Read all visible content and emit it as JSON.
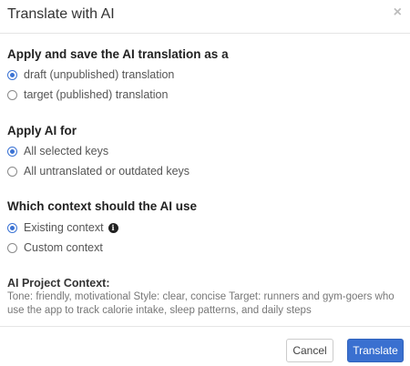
{
  "dialog": {
    "title": "Translate with AI",
    "close_symbol": "×"
  },
  "sections": {
    "apply_save": {
      "title": "Apply and save the AI translation as a",
      "options": [
        {
          "label": "draft (unpublished) translation",
          "checked": true
        },
        {
          "label": "target (published) translation",
          "checked": false
        }
      ]
    },
    "apply_for": {
      "title": "Apply AI for",
      "options": [
        {
          "label": "All selected keys",
          "checked": true
        },
        {
          "label": "All untranslated or outdated keys",
          "checked": false
        }
      ]
    },
    "context": {
      "title": "Which context should the AI use",
      "options": [
        {
          "label": "Existing context",
          "checked": true
        },
        {
          "label": "Custom context",
          "checked": false
        }
      ]
    }
  },
  "project_context": {
    "title": "AI Project Context:",
    "text": "Tone: friendly, motivational Style: clear, concise Target: runners and gym-goers who use the app to track calorie intake, sleep patterns, and daily steps"
  },
  "footer": {
    "cancel_label": "Cancel",
    "translate_label": "Translate"
  },
  "colors": {
    "accent": "#3a70d0",
    "radio_checked": "#3b73d4"
  },
  "icons": {
    "info": "info-icon",
    "close": "close-icon"
  }
}
